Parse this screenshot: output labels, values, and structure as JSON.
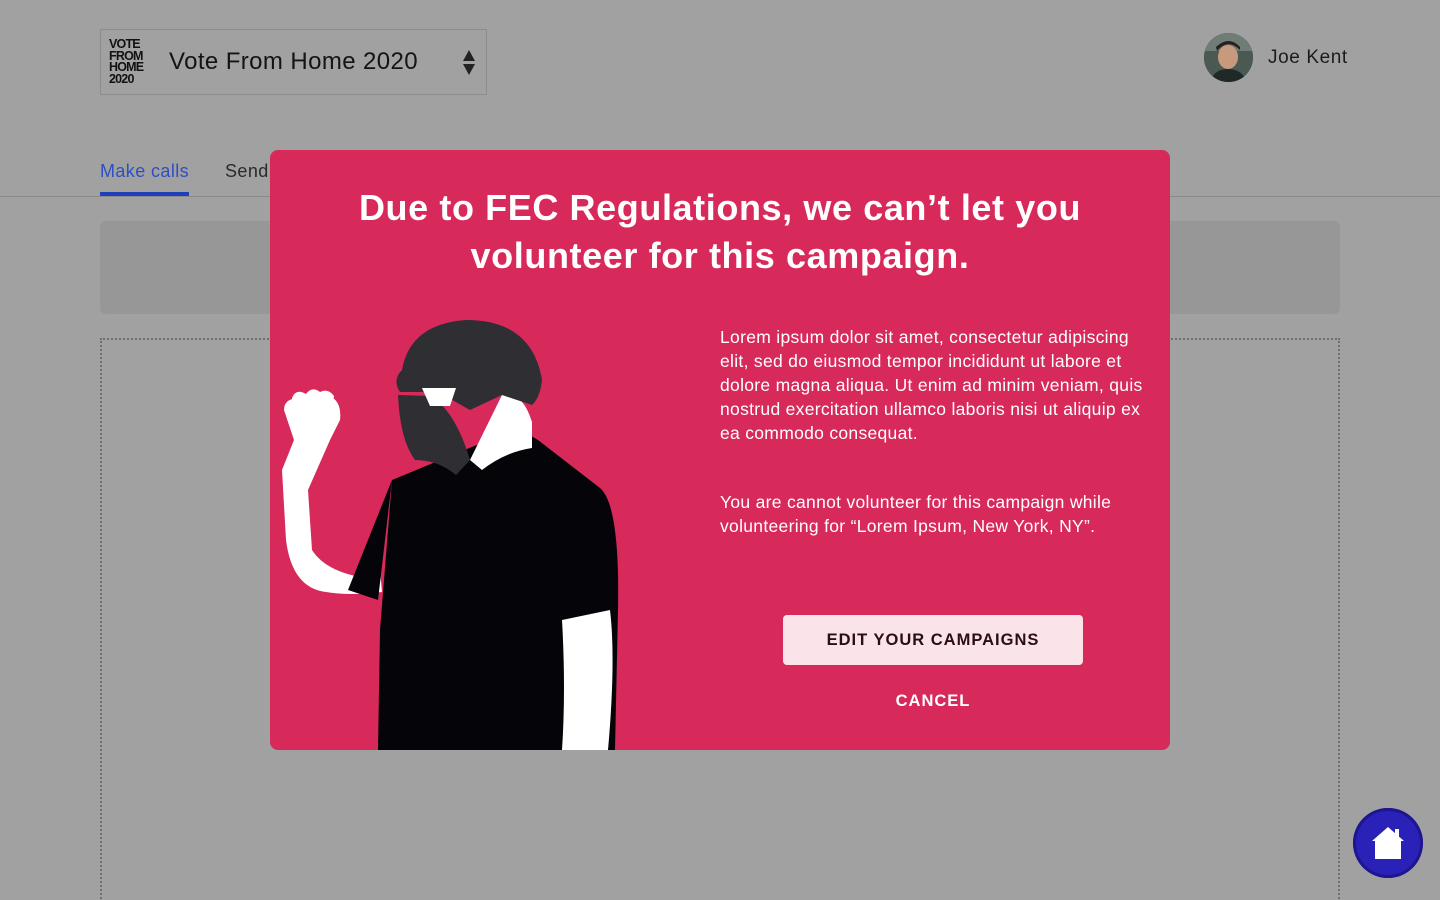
{
  "header": {
    "logo_lines": [
      "VOTE",
      "FROM",
      "HOME",
      "2020"
    ],
    "campaign_name": "Vote From Home 2020",
    "user_name": "Joe Kent"
  },
  "tabs": [
    {
      "label": "Make calls",
      "active": true
    },
    {
      "label": "Send",
      "active": false
    }
  ],
  "modal": {
    "title": "Due to FEC Regulations, we can’t let you volunteer for this campaign.",
    "paragraph_1": "Lorem ipsum dolor sit amet, consectetur adipiscing elit, sed do eiusmod tempor incididunt ut labore et dolore magna aliqua. Ut enim ad minim veniam, quis nostrud exercitation ullamco laboris nisi ut aliquip ex ea commodo consequat.",
    "paragraph_2": "You are cannot volunteer for this campaign while volunteering for “Lorem Ipsum, New York, NY”.",
    "primary_button": "EDIT YOUR CAMPAIGNS",
    "cancel_button": "CANCEL"
  },
  "colors": {
    "modal_bg": "#d8295b",
    "overlay_bg": "#a1a1a1",
    "active_tab": "#2d4fc4",
    "fab": "#2a22b8"
  },
  "icons": {
    "switcher": "up-down-arrows-icon",
    "fab": "home-icon"
  }
}
